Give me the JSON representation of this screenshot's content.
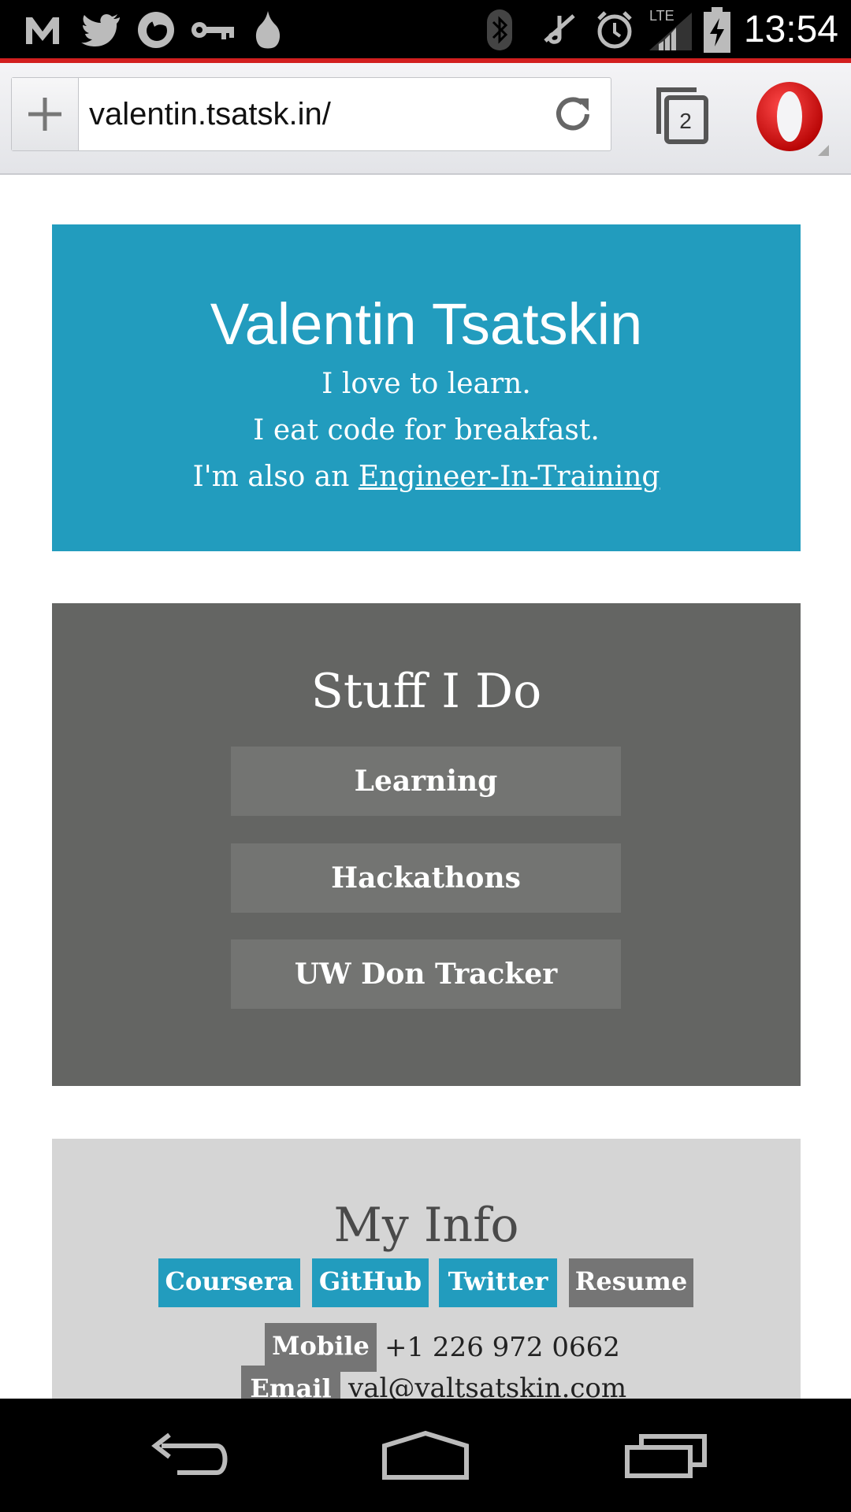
{
  "status_bar": {
    "time": "13:54",
    "left_icons": [
      "gmail-icon",
      "twitter-icon",
      "firefox-icon",
      "key-icon",
      "garlic-icon"
    ],
    "right_icons": [
      "bluetooth-icon",
      "mute-icon",
      "alarm-icon",
      "lte-signal-icon",
      "battery-charging-icon"
    ],
    "network_label": "LTE"
  },
  "browser": {
    "url": "valentin.tsatsk.in/",
    "tab_count": "2",
    "accent_color": "#d21f1f"
  },
  "hero": {
    "name": "Valentin Tsatskin",
    "line1": "I love to learn.",
    "line2": "I eat code for breakfast.",
    "line3_prefix": "I'm also an ",
    "line3_link": "Engineer-In-Training",
    "background": "#229cbe"
  },
  "stuff": {
    "title": "Stuff I Do",
    "buttons": [
      "Learning",
      "Hackathons",
      "UW Don Tracker"
    ],
    "background": "#646563"
  },
  "info": {
    "title": "My Info",
    "links": [
      "Coursera",
      "GitHub",
      "Twitter",
      "Resume"
    ],
    "mobile_label": "Mobile",
    "mobile_value": "+1 226 972 0662",
    "email_label": "Email",
    "email_value": "val@valtsatskin.com",
    "background": "#d5d5d5"
  },
  "nav": {
    "buttons": [
      "back-icon",
      "home-icon",
      "recents-icon"
    ]
  }
}
